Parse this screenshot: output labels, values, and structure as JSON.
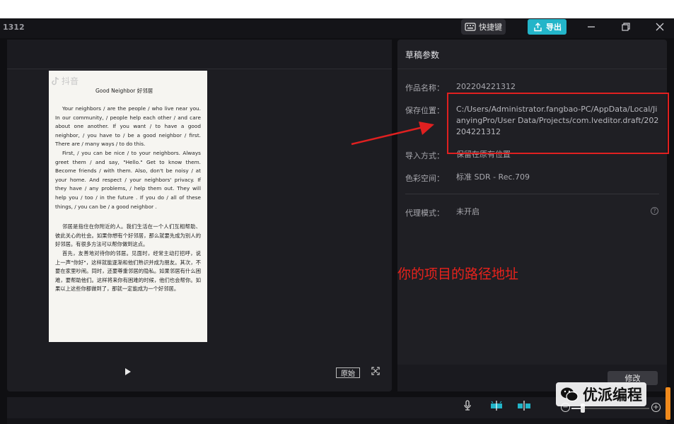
{
  "window": {
    "title_fragment": "1312",
    "shortcut_label": "快捷键",
    "export_label": "导出"
  },
  "preview": {
    "doc_brand": "抖音",
    "doc_title": "Good Neighbor  好邻居",
    "paragraphs_en": [
      "Your neighbors / are the people / who live near you. In our community, / people help each other / and care about one another. If you want / to have a good neighbor, / you have to / be a good neighbor / first. There are / many ways / to do this.",
      "First, / you can be nice / to your neighbors. Always greet them / and say, \"Hello.\" Get to know them. Become friends / with them. Also, don't be noisy / at your home. And respect / your neighbors' privacy. If they have / any problems, / help them out. They will help you / too / in the future . If you do / all of these things, / you can be / a good neighbor ."
    ],
    "paragraphs_cn": [
      "邻居是指住在你附近的人。我们生活在一个人们互相帮助、彼此关心的社会。如果你想有个好邻居，那么就要先成为别人的好邻居。有很多方法可以帮你做到这点。",
      "首先，友善地对待你的邻居。见面时，经常主动打招呼，说上一声\"你好\"，这样就能逐渐和他们熟识并成为朋友。其次，不要在家里吵闹。同时，还要尊重邻居的隐私。如果邻居有什么困难，要帮助他们。这样将来你有困难的时候，他们也会帮你。如果以上这些你都做到了，那就一定能成为一个好邻居。"
    ],
    "original_label": "原始"
  },
  "draft": {
    "title": "草稿参数",
    "rows": [
      {
        "label": "作品名称：",
        "value": "202204221312"
      },
      {
        "label": "保存位置：",
        "value": "C:/Users/Administrator.fangbao-PC/AppData/Local/JianyingPro/User Data/Projects/com.lveditor.draft/202204221312"
      },
      {
        "label": "导入方式：",
        "value": "保留在原有位置"
      },
      {
        "label": "色彩空间：",
        "value": "标准 SDR - Rec.709"
      },
      {
        "label": "代理模式：",
        "value": "未开启"
      }
    ],
    "modify_label": "修改"
  },
  "annotation": {
    "text": "你的项目的路径地址",
    "color": "#e8221c"
  },
  "watermark": {
    "text": "优派编程"
  },
  "colors": {
    "accent": "#23b5c9",
    "annotation_red": "#e02020"
  }
}
